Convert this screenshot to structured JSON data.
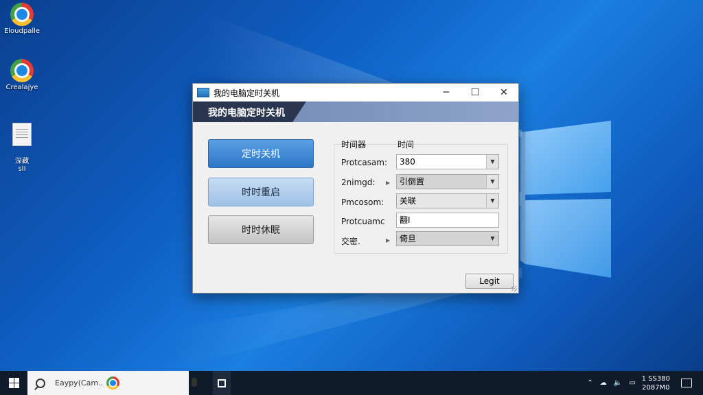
{
  "desktop": {
    "icons": [
      {
        "label": "Eloudpalle"
      },
      {
        "label": "Crealajye"
      },
      {
        "label": "深藏\nsII"
      }
    ]
  },
  "window": {
    "title": "我的电脑定时关机",
    "banner": "我的电脑定时关机",
    "controls": {
      "minimize": "─",
      "maximize": "☐",
      "close": "✕"
    },
    "buttons": {
      "shutdown": "定时关机",
      "restart": "时时重启",
      "sleep": "时时休眠"
    },
    "headers": {
      "col1": "时间器",
      "col2": "时间"
    },
    "rows": [
      {
        "label": "Protcasam:",
        "value": "380"
      },
      {
        "label": "2nimgd:",
        "value": "引倒置"
      },
      {
        "label": "Pmcosom:",
        "value": "关联"
      },
      {
        "label": "Protcuamc",
        "value": "翻I"
      },
      {
        "label": "交密.",
        "value": "倚旦"
      }
    ],
    "login_label": "Legit"
  },
  "taskbar": {
    "search_text": "Eaypy(Cam..",
    "clock_time": "1 SS380",
    "clock_date": "2087M0"
  }
}
